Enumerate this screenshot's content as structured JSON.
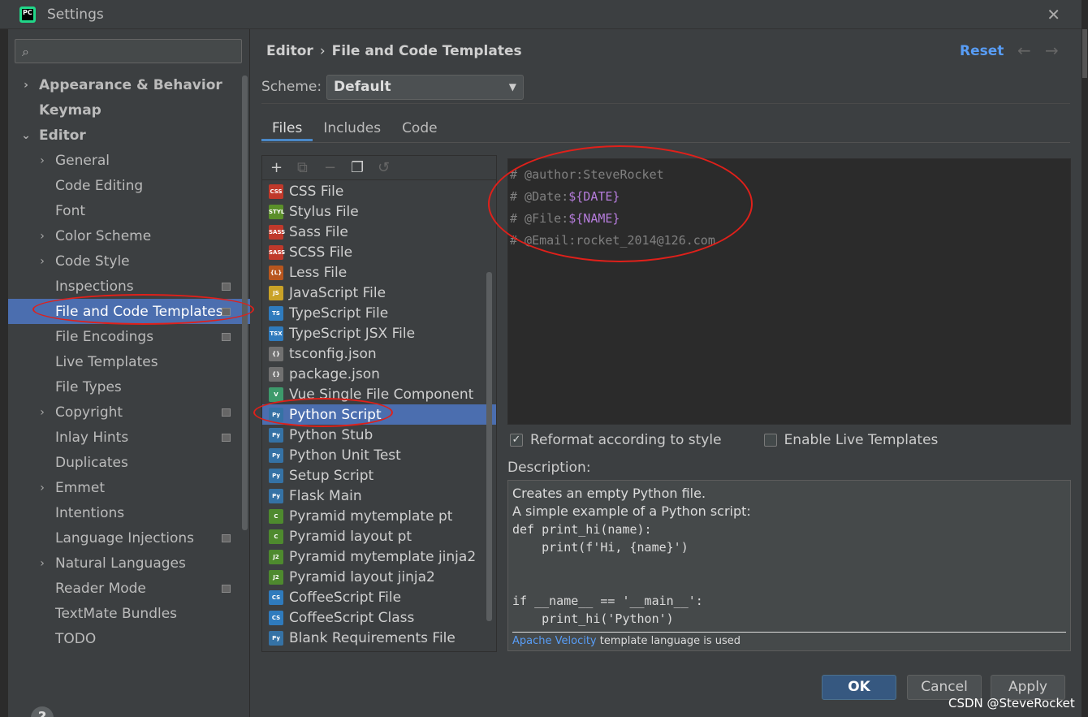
{
  "window": {
    "title": "Settings"
  },
  "sidebar": {
    "items": [
      {
        "label": "Appearance & Behavior",
        "level": 0,
        "chevron": "›",
        "bold": true
      },
      {
        "label": "Keymap",
        "level": 0,
        "chevron": "",
        "bold": true
      },
      {
        "label": "Editor",
        "level": 0,
        "chevron": "⌄",
        "bold": true
      },
      {
        "label": "General",
        "level": 1,
        "chevron": "›"
      },
      {
        "label": "Code Editing",
        "level": 1,
        "chevron": ""
      },
      {
        "label": "Font",
        "level": 1,
        "chevron": ""
      },
      {
        "label": "Color Scheme",
        "level": 1,
        "chevron": "›"
      },
      {
        "label": "Code Style",
        "level": 1,
        "chevron": "›"
      },
      {
        "label": "Inspections",
        "level": 1,
        "chevron": "",
        "project": true
      },
      {
        "label": "File and Code Templates",
        "level": 1,
        "chevron": "",
        "selected": true,
        "project": true
      },
      {
        "label": "File Encodings",
        "level": 1,
        "chevron": "",
        "project": true
      },
      {
        "label": "Live Templates",
        "level": 1,
        "chevron": ""
      },
      {
        "label": "File Types",
        "level": 1,
        "chevron": ""
      },
      {
        "label": "Copyright",
        "level": 1,
        "chevron": "›",
        "project": true
      },
      {
        "label": "Inlay Hints",
        "level": 1,
        "chevron": "",
        "project": true
      },
      {
        "label": "Duplicates",
        "level": 1,
        "chevron": ""
      },
      {
        "label": "Emmet",
        "level": 1,
        "chevron": "›"
      },
      {
        "label": "Intentions",
        "level": 1,
        "chevron": ""
      },
      {
        "label": "Language Injections",
        "level": 1,
        "chevron": "",
        "project": true
      },
      {
        "label": "Natural Languages",
        "level": 1,
        "chevron": "›"
      },
      {
        "label": "Reader Mode",
        "level": 1,
        "chevron": "",
        "project": true
      },
      {
        "label": "TextMate Bundles",
        "level": 1,
        "chevron": ""
      },
      {
        "label": "TODO",
        "level": 1,
        "chevron": ""
      }
    ],
    "help_label": "?"
  },
  "header": {
    "crumb_parent": "Editor",
    "crumb_sep": "›",
    "crumb_current": "File and Code Templates",
    "reset_label": "Reset",
    "back_arrow": "←",
    "forward_arrow": "→"
  },
  "scheme": {
    "label": "Scheme:",
    "value": "Default"
  },
  "tabs": [
    "Files",
    "Includes",
    "Code"
  ],
  "toolbar": {
    "add": "+",
    "copy_dis": "⧉",
    "remove": "−",
    "duplicate": "❐",
    "revert": "↺"
  },
  "files": [
    {
      "label": "CSS File",
      "badge": "CSS",
      "color": "#c0392b"
    },
    {
      "label": "Stylus File",
      "badge": "STYL",
      "color": "#5a8f29"
    },
    {
      "label": "Sass File",
      "badge": "SASS",
      "color": "#c0392b"
    },
    {
      "label": "SCSS File",
      "badge": "SASS",
      "color": "#c0392b"
    },
    {
      "label": "Less File",
      "badge": "{L}",
      "color": "#b8561e"
    },
    {
      "label": "JavaScript File",
      "badge": "JS",
      "color": "#c9a227"
    },
    {
      "label": "TypeScript File",
      "badge": "TS",
      "color": "#2f7bbd"
    },
    {
      "label": "TypeScript JSX File",
      "badge": "TSX",
      "color": "#2f7bbd"
    },
    {
      "label": "tsconfig.json",
      "badge": "{}",
      "color": "#707070"
    },
    {
      "label": "package.json",
      "badge": "{}",
      "color": "#707070"
    },
    {
      "label": "Vue Single File Component",
      "badge": "V",
      "color": "#3d9a6b"
    },
    {
      "label": "Python Script",
      "badge": "Py",
      "color": "#3572a5",
      "selected": true
    },
    {
      "label": "Python Stub",
      "badge": "Py",
      "color": "#3572a5"
    },
    {
      "label": "Python Unit Test",
      "badge": "Py",
      "color": "#3572a5"
    },
    {
      "label": "Setup Script",
      "badge": "Py",
      "color": "#3572a5"
    },
    {
      "label": "Flask Main",
      "badge": "Py",
      "color": "#3572a5"
    },
    {
      "label": "Pyramid mytemplate pt",
      "badge": "C",
      "color": "#4e8a2e"
    },
    {
      "label": "Pyramid layout pt",
      "badge": "C",
      "color": "#4e8a2e"
    },
    {
      "label": "Pyramid mytemplate jinja2",
      "badge": "J2",
      "color": "#4e8a2e"
    },
    {
      "label": "Pyramid layout jinja2",
      "badge": "J2",
      "color": "#4e8a2e"
    },
    {
      "label": "CoffeeScript File",
      "badge": "CS",
      "color": "#2f7bbd"
    },
    {
      "label": "CoffeeScript Class",
      "badge": "CS",
      "color": "#2f7bbd"
    },
    {
      "label": "Blank Requirements File",
      "badge": "Py",
      "color": "#3572a5"
    }
  ],
  "editor": {
    "lines": [
      {
        "prefix": "# @author:SteveRocket",
        "var": ""
      },
      {
        "prefix": "# @Date:",
        "var": "${DATE}"
      },
      {
        "prefix": "# @File:",
        "var": "${NAME}"
      },
      {
        "prefix": "# @Email:rocket_2014@126.com",
        "var": ""
      }
    ]
  },
  "options": {
    "reformat_label": "Reformat according to style",
    "reformat_checked": true,
    "live_label": "Enable Live Templates",
    "live_checked": false,
    "check_mark": "✓"
  },
  "description": {
    "label": "Description:",
    "line1": "Creates an empty Python file.",
    "line2": "A simple example of a Python script:",
    "code": "def print_hi(name):\n    print(f'Hi, {name}')\n\n\nif __name__ == '__main__':\n    print_hi('Python')",
    "footer_link": "Apache Velocity",
    "footer_text": " template language is used"
  },
  "buttons": {
    "ok": "OK",
    "cancel": "Cancel",
    "apply": "Apply"
  },
  "watermark": "CSDN @SteveRocket",
  "colors": {
    "accent": "#4b6eaf",
    "link": "#589df6",
    "annotation": "#e0201a"
  }
}
